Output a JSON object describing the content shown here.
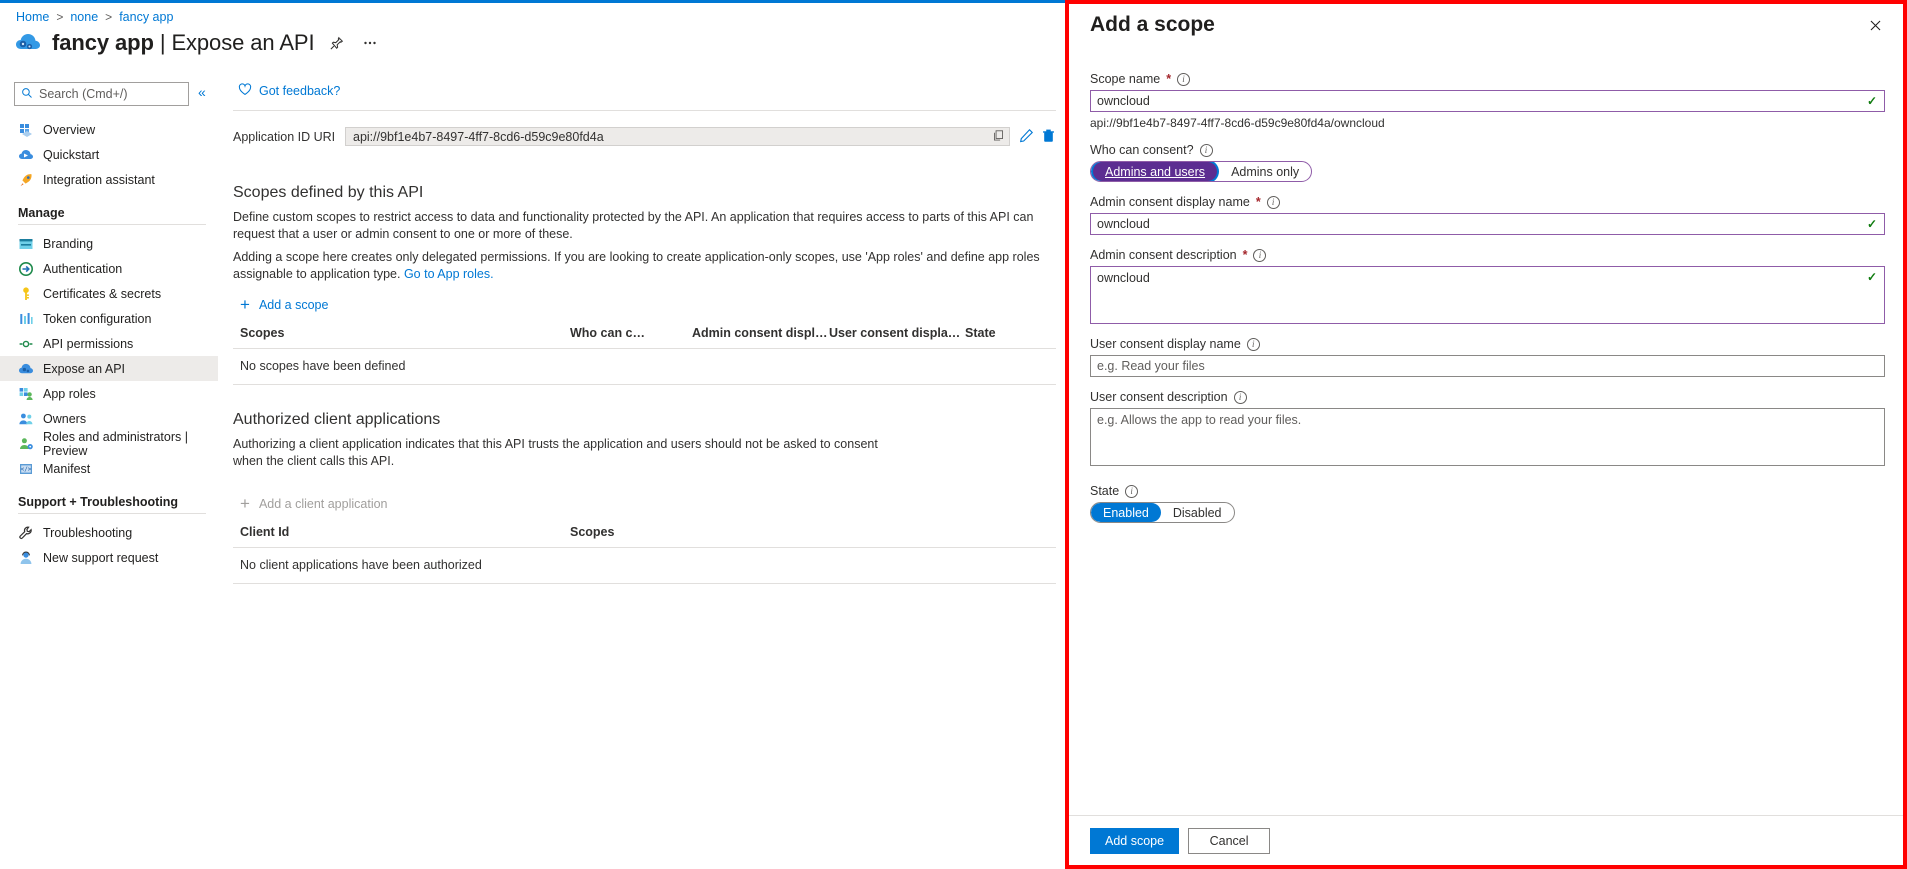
{
  "breadcrumb": {
    "items": [
      "Home",
      "none",
      "fancy app"
    ],
    "separator": ">"
  },
  "header": {
    "app_icon": "cloud-gears-icon",
    "title_main": "fancy app",
    "title_separator": "|",
    "title_sub": "Expose an API",
    "pin_icon": "pin-icon",
    "more_icon": "ellipsis-icon"
  },
  "sidebar": {
    "search_placeholder": "Search (Cmd+/)",
    "collapse_icon": "chevron-double-left-icon",
    "items": [
      {
        "label": "Overview",
        "icon": "grid-overview-icon",
        "selected": false
      },
      {
        "label": "Quickstart",
        "icon": "cloud-quickstart-icon",
        "selected": false
      },
      {
        "label": "Integration assistant",
        "icon": "rocket-icon",
        "selected": false
      }
    ],
    "groups": [
      {
        "title": "Manage",
        "items": [
          {
            "label": "Branding",
            "icon": "branding-icon",
            "selected": false
          },
          {
            "label": "Authentication",
            "icon": "authentication-icon",
            "selected": false
          },
          {
            "label": "Certificates & secrets",
            "icon": "key-icon",
            "selected": false
          },
          {
            "label": "Token configuration",
            "icon": "token-bars-icon",
            "selected": false
          },
          {
            "label": "API permissions",
            "icon": "api-permissions-icon",
            "selected": false
          },
          {
            "label": "Expose an API",
            "icon": "cloud-api-icon",
            "selected": true
          },
          {
            "label": "App roles",
            "icon": "app-roles-icon",
            "selected": false
          },
          {
            "label": "Owners",
            "icon": "owners-icon",
            "selected": false
          },
          {
            "label": "Roles and administrators | Preview",
            "icon": "roles-admin-icon",
            "selected": false
          },
          {
            "label": "Manifest",
            "icon": "manifest-icon",
            "selected": false
          }
        ]
      },
      {
        "title": "Support + Troubleshooting",
        "items": [
          {
            "label": "Troubleshooting",
            "icon": "wrench-icon",
            "selected": false
          },
          {
            "label": "New support request",
            "icon": "support-person-icon",
            "selected": false
          }
        ]
      }
    ]
  },
  "main": {
    "feedback_label": "Got feedback?",
    "feedback_icon": "heart-icon",
    "app_id_uri": {
      "label": "Application ID URI",
      "value": "api://9bf1e4b7-8497-4ff7-8cd6-d59c9e80fd4a",
      "copy_icon": "copy-icon",
      "edit_icon": "pencil-icon",
      "delete_icon": "trash-icon"
    },
    "scopes_section": {
      "title": "Scopes defined by this API",
      "para1": "Define custom scopes to restrict access to data and functionality protected by the API. An application that requires access to parts of this API can request that a user or admin consent to one or more of these.",
      "para2_before": "Adding a scope here creates only delegated permissions. If you are looking to create application-only scopes, use 'App roles' and define app roles assignable to application type. ",
      "para2_link": "Go to App roles.",
      "add_scope_label": "Add a scope",
      "add_icon": "plus-icon",
      "columns": [
        "Scopes",
        "Who can consent",
        "Admin consent display ...",
        "User consent display na...",
        "State"
      ],
      "empty_text": "No scopes have been defined"
    },
    "clients_section": {
      "title": "Authorized client applications",
      "para": "Authorizing a client application indicates that this API trusts the application and users should not be asked to consent when the client calls this API.",
      "add_client_label": "Add a client application",
      "add_icon": "plus-icon",
      "columns": [
        "Client Id",
        "Scopes"
      ],
      "empty_text": "No client applications have been authorized"
    }
  },
  "panel": {
    "title": "Add a scope",
    "close_icon": "close-icon",
    "highlight_color": "#ff0000",
    "fields": {
      "scope_name": {
        "label": "Scope name",
        "required": true,
        "value": "owncloud",
        "hint": "api://9bf1e4b7-8497-4ff7-8cd6-d59c9e80fd4a/owncloud",
        "valid": true
      },
      "who_can_consent": {
        "label": "Who can consent?",
        "options": [
          "Admins and users",
          "Admins only"
        ],
        "selected": "Admins and users"
      },
      "admin_consent_display_name": {
        "label": "Admin consent display name",
        "required": true,
        "value": "owncloud",
        "valid": true
      },
      "admin_consent_description": {
        "label": "Admin consent description",
        "required": true,
        "value": "owncloud",
        "valid": true
      },
      "user_consent_display_name": {
        "label": "User consent display name",
        "required": false,
        "value": "",
        "placeholder": "e.g. Read your files"
      },
      "user_consent_description": {
        "label": "User consent description",
        "required": false,
        "value": "",
        "placeholder": "e.g. Allows the app to read your files."
      },
      "state": {
        "label": "State",
        "options": [
          "Enabled",
          "Disabled"
        ],
        "selected": "Enabled"
      }
    },
    "footer": {
      "submit_label": "Add scope",
      "cancel_label": "Cancel"
    }
  }
}
